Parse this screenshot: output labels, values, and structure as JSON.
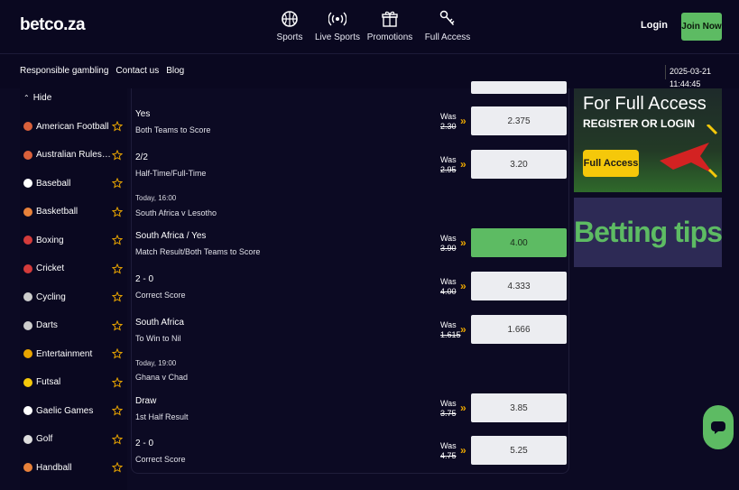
{
  "header": {
    "logo": "betco.za",
    "nav": [
      {
        "label": "Sports",
        "icon": "basketball-icon"
      },
      {
        "label": "Live Sports",
        "icon": "broadcast-icon"
      },
      {
        "label": "Promotions",
        "icon": "gift-icon"
      },
      {
        "label": "Full Access",
        "icon": "key-icon"
      }
    ],
    "login_label": "Login",
    "join_label": "Join Now"
  },
  "subbar": {
    "links": [
      "Responsible gambling",
      "Contact us",
      "Blog"
    ],
    "datetime": "2025-03-21 11:44:45"
  },
  "sidebar": {
    "hide_label": "Hide",
    "sports": [
      {
        "name": "American Football",
        "icon": "american-football-icon",
        "color": "#d9603b"
      },
      {
        "name": "Australian Rules Football",
        "icon": "aussie-rules-icon",
        "color": "#d9603b"
      },
      {
        "name": "Baseball",
        "icon": "baseball-icon",
        "color": "#ffffff"
      },
      {
        "name": "Basketball",
        "icon": "basketball-icon",
        "color": "#e8813a"
      },
      {
        "name": "Boxing",
        "icon": "boxing-glove-icon",
        "color": "#d33b3b"
      },
      {
        "name": "Cricket",
        "icon": "cricket-icon",
        "color": "#d33b3b"
      },
      {
        "name": "Cycling",
        "icon": "bicycle-icon",
        "color": "#cccccc"
      },
      {
        "name": "Darts",
        "icon": "dartboard-icon",
        "color": "#cccccc"
      },
      {
        "name": "Entertainment",
        "icon": "entertainment-icon",
        "color": "#e8a400"
      },
      {
        "name": "Futsal",
        "icon": "futsal-ball-icon",
        "color": "#f5c80a"
      },
      {
        "name": "Gaelic Games",
        "icon": "trophy-icon",
        "color": "#ffffff"
      },
      {
        "name": "Golf",
        "icon": "golf-ball-icon",
        "color": "#dddddd"
      },
      {
        "name": "Handball",
        "icon": "handball-icon",
        "color": "#e8813a"
      }
    ]
  },
  "bets": [
    {
      "selection": "Yes",
      "market": "Both Teams to Score",
      "was_label": "Was",
      "was": "2.30",
      "odds": "2.375",
      "active": false
    },
    {
      "selection": "2/2",
      "market": "Half-Time/Full-Time",
      "was_label": "Was",
      "was": "2.95",
      "odds": "3.20",
      "active": false
    },
    {
      "selection": "South Africa / Yes",
      "market": "Match Result/Both Teams to Score",
      "was_label": "Was",
      "was": "3.90",
      "odds": "4.00",
      "active": true
    },
    {
      "selection": "2 - 0",
      "market": "Correct Score",
      "was_label": "Was",
      "was": "4.00",
      "odds": "4.333",
      "active": false
    },
    {
      "selection": "South Africa",
      "market": "To Win to Nil",
      "was_label": "Was",
      "was": "1.615",
      "odds": "1.666",
      "active": false
    },
    {
      "selection": "Draw",
      "market": "1st Half Result",
      "was_label": "Was",
      "was": "3.75",
      "odds": "3.85",
      "active": false
    },
    {
      "selection": "2 - 0",
      "market": "Correct Score",
      "was_label": "Was",
      "was": "4.75",
      "odds": "5.25",
      "active": false
    }
  ],
  "matches": [
    {
      "time": "Today, 16:00",
      "name": "South Africa v Lesotho"
    },
    {
      "time": "Today, 19:00",
      "name": "Ghana v Chad"
    }
  ],
  "promos": {
    "banner1_line1": "For Full Access",
    "banner1_line2": "REGISTER OR LOGIN",
    "banner1_button": "Full Access",
    "banner2_text": "Betting tips"
  },
  "colors": {
    "background": "#0c0a23",
    "accent_green": "#5dbb63",
    "arrow_orange": "#e8a400",
    "odds_bg": "#ecedf1"
  }
}
